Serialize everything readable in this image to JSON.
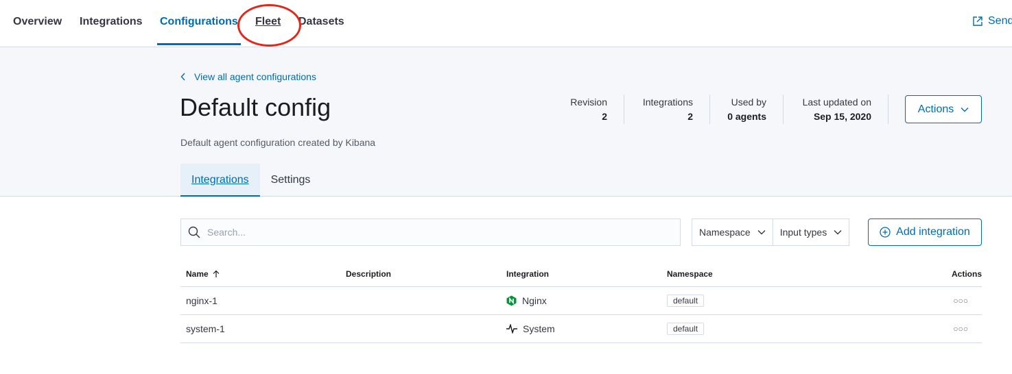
{
  "topnav": {
    "tabs": [
      {
        "label": "Overview"
      },
      {
        "label": "Integrations"
      },
      {
        "label": "Configurations"
      },
      {
        "label": "Fleet"
      },
      {
        "label": "Datasets"
      }
    ],
    "active_tab": "Configurations",
    "send_label": "Send"
  },
  "header": {
    "back_link": "View all agent configurations",
    "title": "Default config",
    "subtitle": "Default agent configuration created by Kibana",
    "stats": [
      {
        "label": "Revision",
        "value": "2"
      },
      {
        "label": "Integrations",
        "value": "2"
      },
      {
        "label": "Used by",
        "value": "0 agents"
      },
      {
        "label": "Last updated on",
        "value": "Sep 15, 2020"
      }
    ],
    "actions_label": "Actions",
    "tabs": [
      {
        "label": "Integrations"
      },
      {
        "label": "Settings"
      }
    ]
  },
  "controls": {
    "search_placeholder": "Search...",
    "filters": [
      {
        "label": "Namespace"
      },
      {
        "label": "Input types"
      }
    ],
    "add_integration_label": "Add integration"
  },
  "table": {
    "columns": [
      "Name",
      "Description",
      "Integration",
      "Namespace",
      "Actions"
    ],
    "rows": [
      {
        "name": "nginx-1",
        "description": "",
        "integration": "Nginx",
        "integration_icon": "nginx-icon",
        "namespace": "default"
      },
      {
        "name": "system-1",
        "description": "",
        "integration": "System",
        "integration_icon": "system-pulse-icon",
        "namespace": "default"
      }
    ]
  },
  "colors": {
    "accent": "#006bb4",
    "highlight": "#e0281b",
    "header_bg": "#f5f7fa",
    "nginx_green": "#009639"
  }
}
